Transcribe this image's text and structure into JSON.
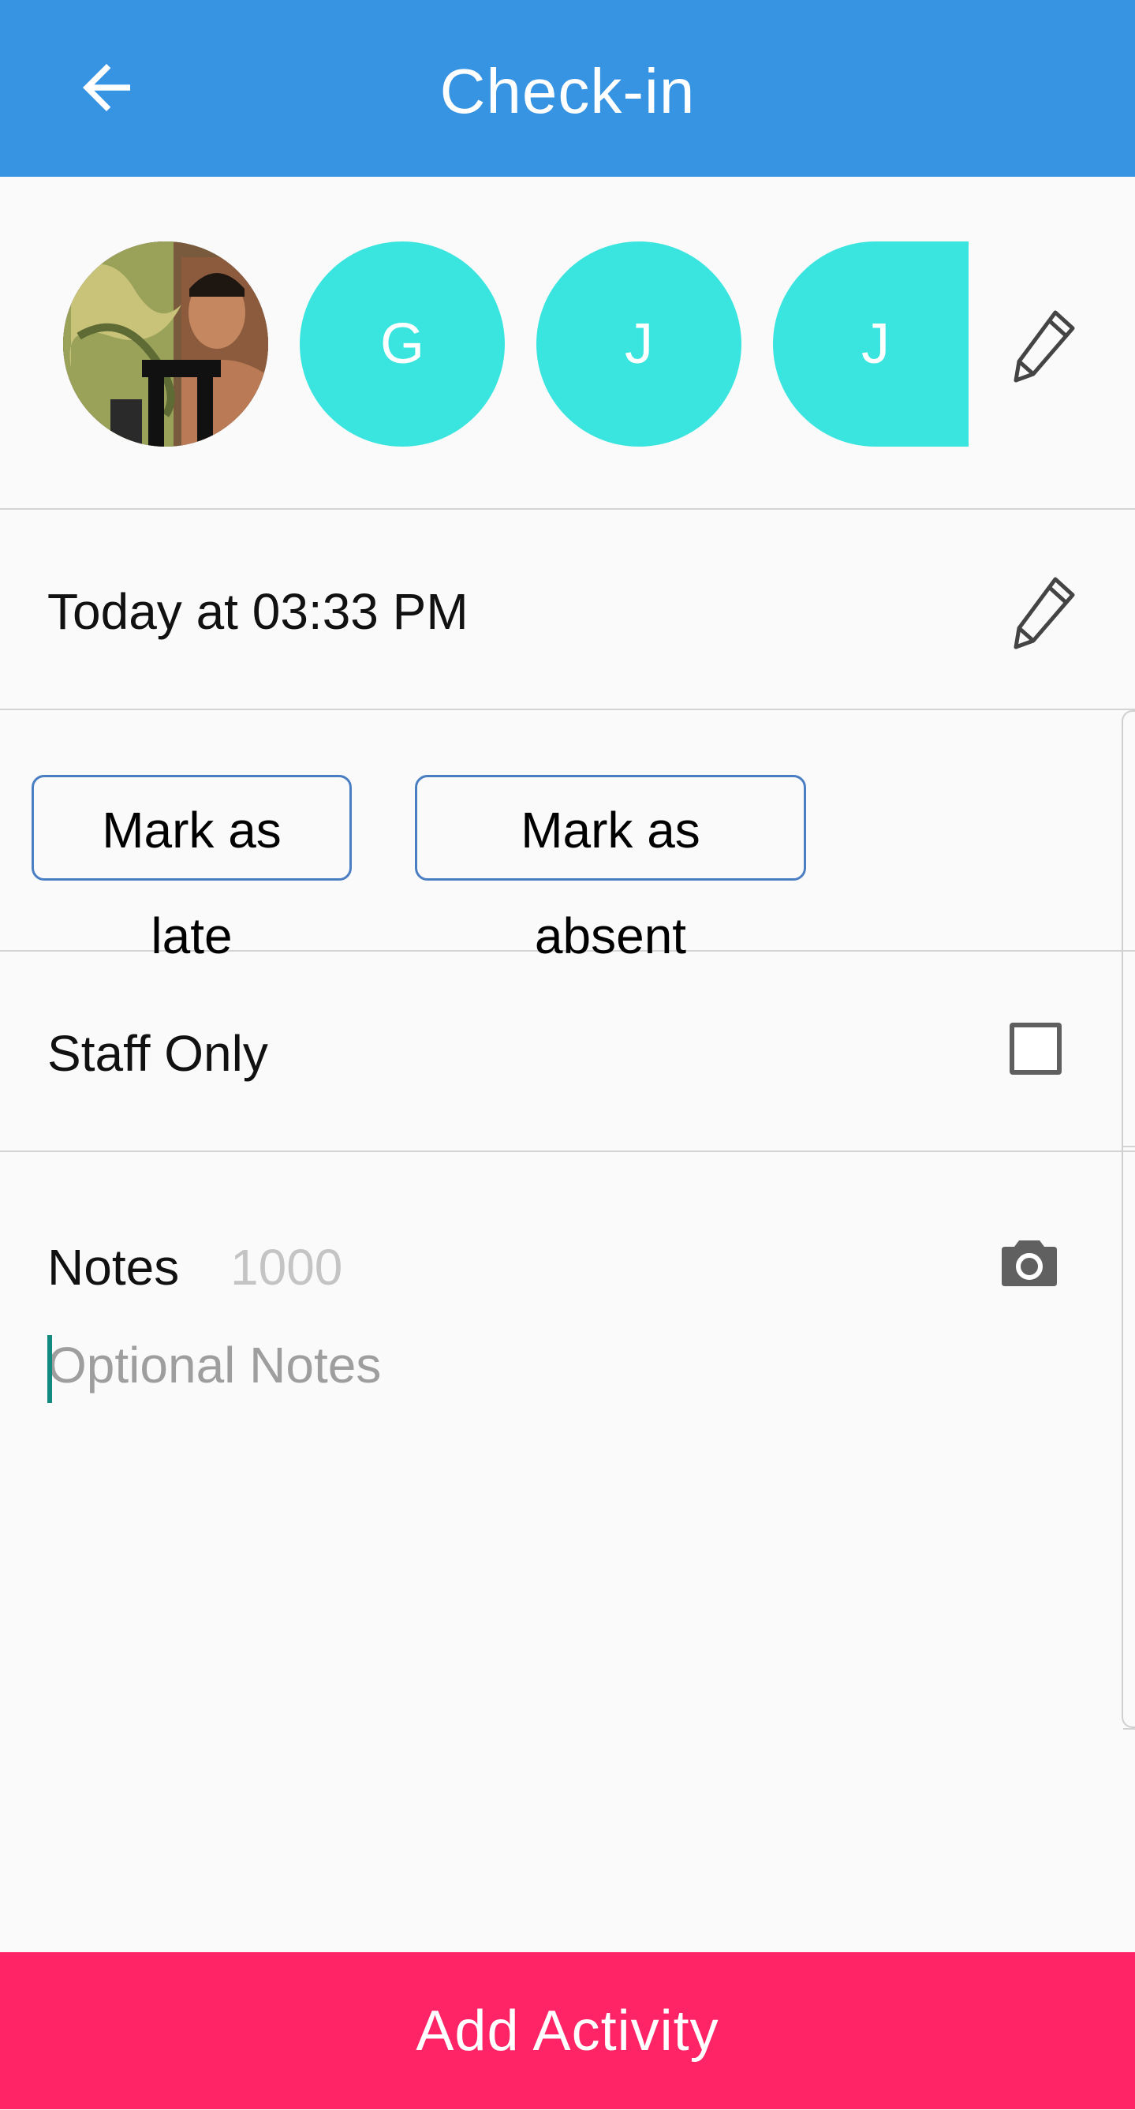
{
  "app_bar": {
    "title": "Check-in",
    "back_icon": "arrow-left-icon",
    "background": "#3794e2"
  },
  "participants": [
    {
      "type": "photo",
      "initial": ""
    },
    {
      "type": "initial",
      "initial": "G"
    },
    {
      "type": "initial",
      "initial": "J"
    },
    {
      "type": "initial",
      "initial": "J"
    }
  ],
  "participant_color": "#3ae5df",
  "time": {
    "label": "Today at 03:33 PM"
  },
  "marks": {
    "late_label": "Mark as late",
    "absent_label": "Mark as absent"
  },
  "staff_only": {
    "label": "Staff Only",
    "checked": false
  },
  "notes": {
    "label": "Notes",
    "counter": "1000",
    "placeholder": "Optional Notes",
    "value": ""
  },
  "footer": {
    "add_label": "Add Activity",
    "color": "#fe2466"
  }
}
